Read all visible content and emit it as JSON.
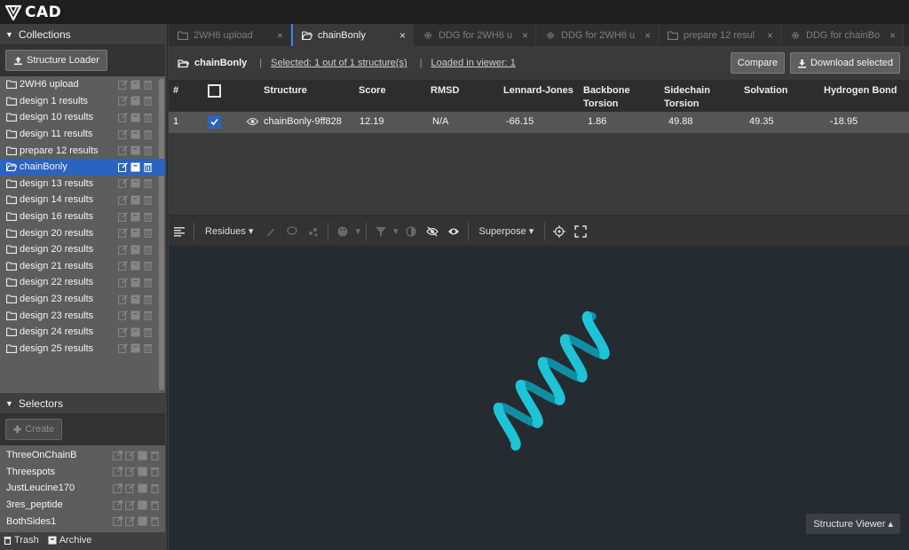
{
  "app": {
    "title": "CAD"
  },
  "collections": {
    "header": "Collections",
    "loader_button": "Structure Loader",
    "items": [
      {
        "label": "2WH6 upload"
      },
      {
        "label": "design 1 results"
      },
      {
        "label": "design 10 results"
      },
      {
        "label": "design 11 results"
      },
      {
        "label": "prepare 12 results"
      },
      {
        "label": "chainBonly"
      },
      {
        "label": "design 13 results"
      },
      {
        "label": "design 14 results"
      },
      {
        "label": "design 16 results"
      },
      {
        "label": "design 20 results"
      },
      {
        "label": "design 20 results"
      },
      {
        "label": "design 21 results"
      },
      {
        "label": "design 22 results"
      },
      {
        "label": "design 23 results"
      },
      {
        "label": "design 23 results"
      },
      {
        "label": "design 24 results"
      },
      {
        "label": "design 25 results"
      }
    ]
  },
  "selectors": {
    "header": "Selectors",
    "create_button": "Create",
    "items": [
      {
        "label": "ThreeOnChainB"
      },
      {
        "label": "Threespots"
      },
      {
        "label": "JustLeucine170"
      },
      {
        "label": "3res_peptide"
      },
      {
        "label": "BothSides1"
      }
    ]
  },
  "footer": {
    "trash": "Trash",
    "archive": "Archive"
  },
  "tabs": [
    {
      "label": "2WH6 upload",
      "icon": "folder-icon"
    },
    {
      "label": "chainBonly",
      "icon": "folder-open-icon"
    },
    {
      "label": "DDG for 2WH6 u",
      "icon": "gear-icon"
    },
    {
      "label": "DDG for 2WH6 u",
      "icon": "gear-icon"
    },
    {
      "label": "prepare 12 resul",
      "icon": "folder-icon"
    },
    {
      "label": "DDG for chainBo",
      "icon": "gear-icon"
    }
  ],
  "info": {
    "title": "chainBonly",
    "selected": "Selected: 1 out of 1 structure(s)",
    "loaded": "Loaded in viewer: 1",
    "compare": "Compare",
    "download": "Download selected"
  },
  "table": {
    "headers": {
      "num": "#",
      "structure": "Structure",
      "score": "Score",
      "rmsd": "RMSD",
      "lj": "Lennard-Jones",
      "bb1": "Backbone",
      "bb2": "Torsion",
      "sc1": "Sidechain",
      "sc2": "Torsion",
      "solv": "Solvation",
      "hb": "Hydrogen Bond"
    },
    "rows": [
      {
        "num": "1",
        "structure": "chainBonly-9ff828",
        "score": "12.19",
        "rmsd": "N/A",
        "lj": "-66.15",
        "bb": "1.86",
        "sc": "49.88",
        "solv": "49.35",
        "hb": "-18.95"
      }
    ]
  },
  "toolbar": {
    "residues": "Residues",
    "superpose": "Superpose"
  },
  "viewer": {
    "mode_button": "Structure Viewer",
    "helix_color": "#1fc3d8"
  }
}
